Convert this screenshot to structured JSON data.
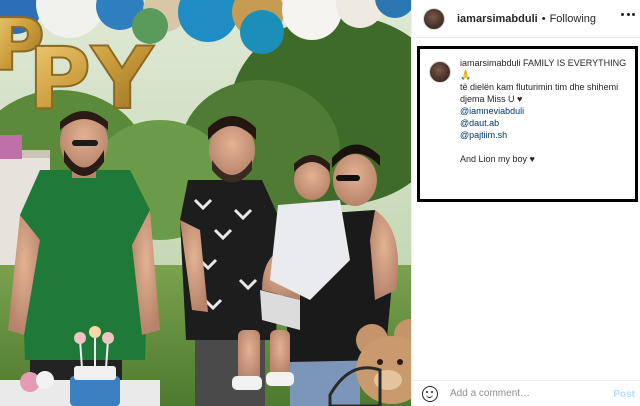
{
  "header": {
    "username": "iamarsimabduli",
    "separator": "•",
    "follow_status": "Following"
  },
  "caption": {
    "username": "iamarsimabduli",
    "text": "FAMILY IS EVERYTHING 🙏",
    "line2": "të dielën kam fluturimin tim dhe shihemi djema Miss U ♥",
    "mentions": [
      "@iamneviabduli",
      "@daut.ab",
      "@pajtiim.sh"
    ],
    "closing": "And Lion my boy ♥"
  },
  "comment": {
    "placeholder": "Add a comment…",
    "post_label": "Post"
  },
  "photo": {
    "balloon_letters": "PY"
  },
  "icons": {
    "more": "more-options-icon",
    "emoji": "emoji-icon"
  },
  "colors": {
    "link": "#00376b",
    "post_button": "#b2dffc",
    "border_highlight": "#000000"
  }
}
